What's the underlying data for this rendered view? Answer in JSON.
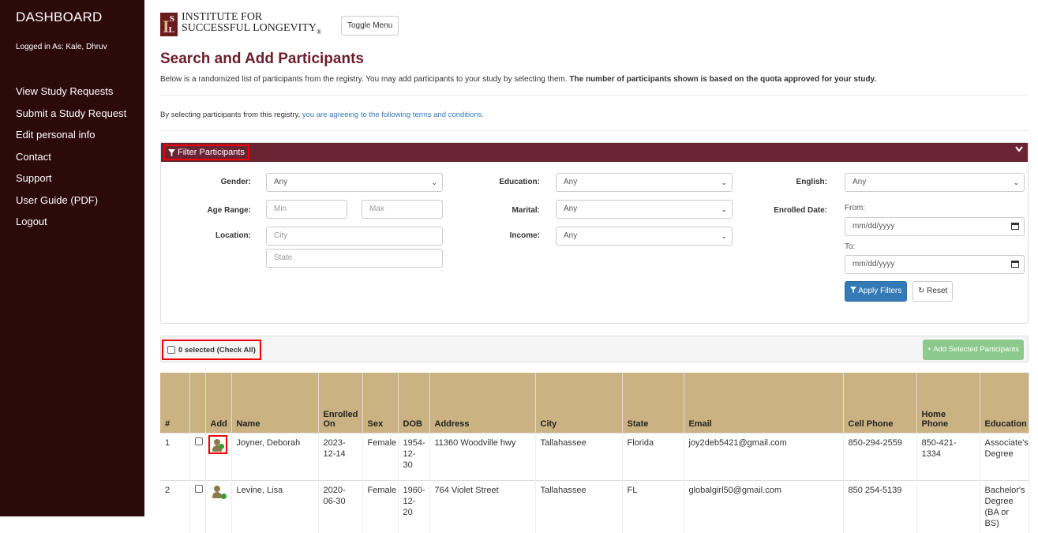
{
  "sidebar": {
    "title": "DASHBOARD",
    "logged_in": "Logged in As: Kale, Dhruv",
    "items": [
      {
        "label": "View Study Requests"
      },
      {
        "label": "Submit a Study Request"
      },
      {
        "label": "Edit personal info"
      },
      {
        "label": "Contact"
      },
      {
        "label": "Support"
      },
      {
        "label": "User Guide (PDF)"
      },
      {
        "label": "Logout"
      }
    ]
  },
  "header": {
    "logo_line1": "INSTITUTE FOR",
    "logo_line2": "SUCCESSFUL LONGEVITY",
    "logo_reg": "®",
    "logo_mark_i": "I",
    "logo_mark_s": "S",
    "logo_mark_l": "L",
    "toggle_label": "Toggle Menu"
  },
  "page": {
    "title": "Search and Add Participants",
    "description": "Below is a randomized list of participants from the registry. You may add participants to your study by selecting them.",
    "description_bold": "The number of participants shown is based on the quota approved for your study.",
    "terms_prefix": "By selecting participants from this registry,",
    "terms_link": "you are agreeing to the following terms and conditions."
  },
  "filter": {
    "header_label": "Filter Participants",
    "gender_label": "Gender:",
    "gender_value": "Any",
    "age_label": "Age Range:",
    "age_min_ph": "Min",
    "age_max_ph": "Max",
    "location_label": "Location:",
    "city_ph": "City",
    "state_ph": "State",
    "education_label": "Education:",
    "education_value": "Any",
    "marital_label": "Marital:",
    "marital_value": "Any",
    "income_label": "Income:",
    "income_value": "Any",
    "english_label": "English:",
    "english_value": "Any",
    "enrolled_label": "Enrolled Date:",
    "from_label": "From:",
    "from_ph": "mm/dd/yyyy",
    "to_label": "To:",
    "to_ph": "mm/dd/yyyy",
    "apply_label": "Apply Filters",
    "reset_label": "Reset"
  },
  "selection": {
    "label": "0 selected  (Check All)",
    "add_selected_label": "+ Add Selected Participants"
  },
  "table": {
    "headers": [
      "#",
      "",
      "Add",
      "Name",
      "Enrolled On",
      "Sex",
      "DOB",
      "Address",
      "City",
      "State",
      "Email",
      "Cell Phone",
      "Home Phone",
      "Education"
    ],
    "rows": [
      {
        "num": "1",
        "name": "Joyner, Deborah",
        "enrolled": "2023-12-14",
        "sex": "Female",
        "dob": "1954-12-30",
        "address": "11360 Woodville hwy",
        "city": "Tallahassee",
        "state": "Florida",
        "email": "joy2deb5421@gmail.com",
        "cell": "850-294-2559",
        "home": "850-421-1334",
        "education": "Associate's Degree"
      },
      {
        "num": "2",
        "name": "Levine, Lisa",
        "enrolled": "2020-06-30",
        "sex": "Female",
        "dob": "1960-12-20",
        "address": "764 Violet Street",
        "city": "Tallahassee",
        "state": "FL",
        "email": "globalgirl50@gmail.com",
        "cell": "850 254-5139",
        "home": "",
        "education": "Bachelor's Degree (BA or BS)"
      }
    ]
  },
  "colors": {
    "sidebar_bg": "#2c0a0a",
    "accent": "#6b2433",
    "table_header": "#cab283",
    "primary_button": "#337ab7",
    "success_button": "#8cc98c",
    "highlight_border": "#ee0000"
  }
}
